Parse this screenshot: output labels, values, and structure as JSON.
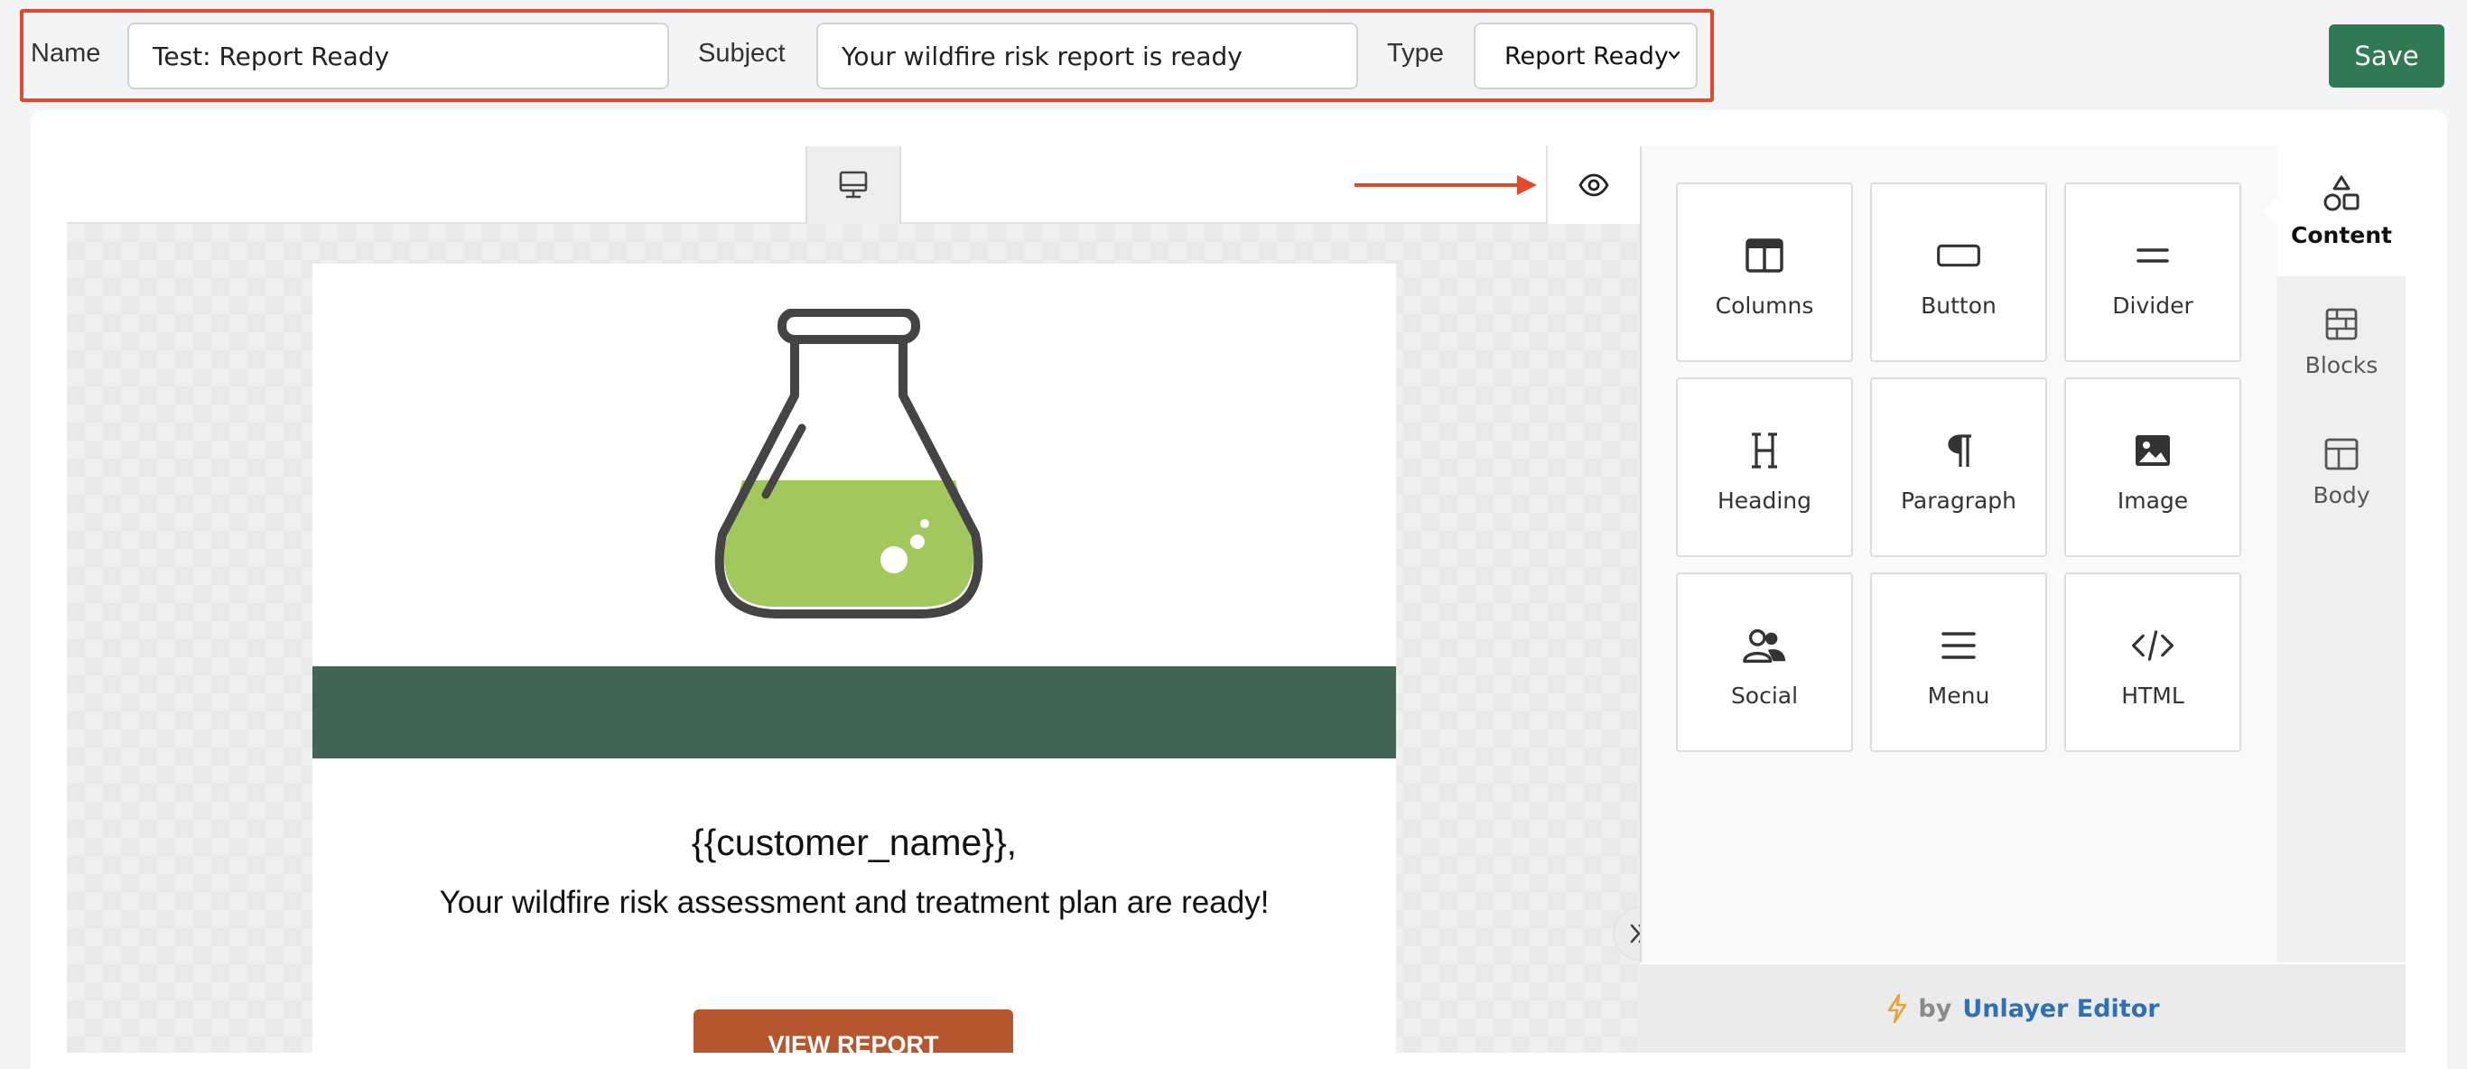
{
  "form": {
    "name_label": "Name",
    "name_value": "Test: Report Ready",
    "subject_label": "Subject",
    "subject_value": "Your wildfire risk report is ready",
    "type_label": "Type",
    "type_value": "Report Ready"
  },
  "toolbar": {
    "save_label": "Save"
  },
  "email": {
    "greeting": "{{customer_name}},",
    "intro": "Your wildfire risk assessment and treatment plan are ready!",
    "cta_label": "VIEW REPORT",
    "band_color": "#426656",
    "cta_color": "#b5562e"
  },
  "tools": [
    {
      "label": "Columns",
      "icon": "columns-icon"
    },
    {
      "label": "Button",
      "icon": "button-icon"
    },
    {
      "label": "Divider",
      "icon": "divider-icon"
    },
    {
      "label": "Heading",
      "icon": "heading-icon"
    },
    {
      "label": "Paragraph",
      "icon": "paragraph-icon"
    },
    {
      "label": "Image",
      "icon": "image-icon"
    },
    {
      "label": "Social",
      "icon": "social-icon"
    },
    {
      "label": "Menu",
      "icon": "menu-icon"
    },
    {
      "label": "HTML",
      "icon": "html-icon"
    }
  ],
  "side_tabs": [
    {
      "label": "Content",
      "icon": "shapes-icon",
      "active": true
    },
    {
      "label": "Blocks",
      "icon": "blocks-icon",
      "active": false
    },
    {
      "label": "Body",
      "icon": "body-icon",
      "active": false
    }
  ],
  "footer": {
    "by": "by",
    "brand": "Unlayer Editor"
  },
  "colors": {
    "accent_save": "#2f7a52",
    "highlight": "#e04a2f",
    "brand_link": "#2f6fb3"
  }
}
